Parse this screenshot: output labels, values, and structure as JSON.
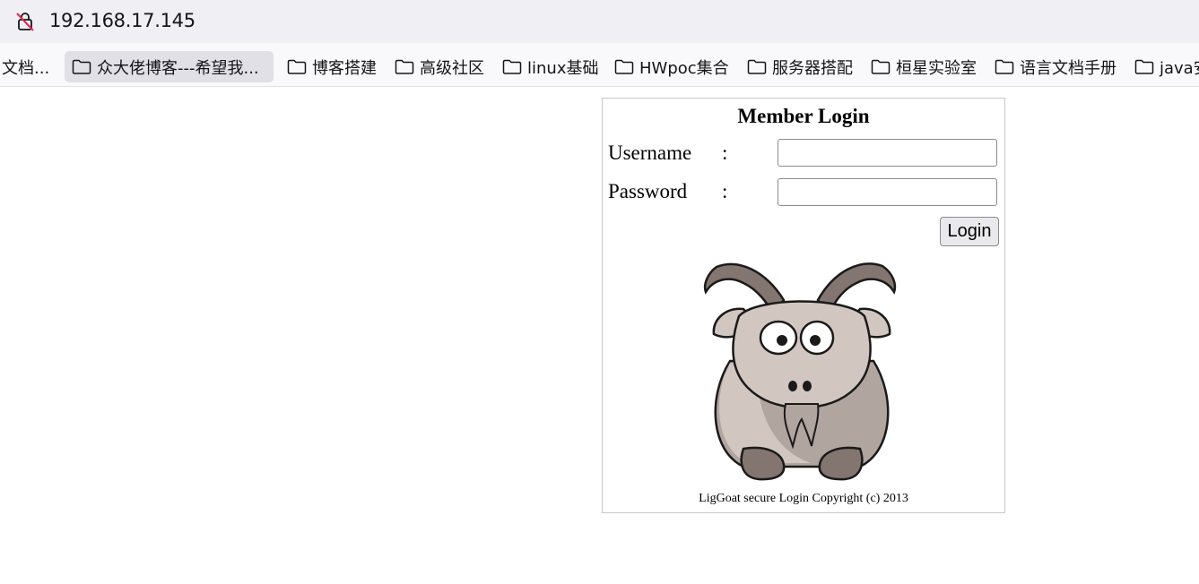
{
  "browser": {
    "url": "192.168.17.145",
    "bookmarks": [
      {
        "label": "文档...",
        "has_icon": false
      },
      {
        "label": "众大佬博客---希望我...",
        "has_icon": true
      },
      {
        "label": "博客搭建",
        "has_icon": true
      },
      {
        "label": "高级社区",
        "has_icon": true
      },
      {
        "label": "linux基础",
        "has_icon": true
      },
      {
        "label": "HWpoc集合",
        "has_icon": true
      },
      {
        "label": "服务器搭配",
        "has_icon": true
      },
      {
        "label": "桓星实验室",
        "has_icon": true
      },
      {
        "label": "语言文档手册",
        "has_icon": true
      },
      {
        "label": "java安",
        "has_icon": true
      }
    ]
  },
  "login": {
    "title": "Member Login",
    "username_label": "Username",
    "password_label": "Password",
    "colon": ":",
    "username_value": "",
    "password_value": "",
    "login_button": "Login",
    "copyright": "LigGoat secure Login Copyright (c) 2013"
  },
  "colors": {
    "urlbar_bg": "#f0f0f4",
    "bookmark_selected_bg": "#e0e0e6",
    "goat_body": "#d2c7c0",
    "goat_horn": "#83756f"
  }
}
